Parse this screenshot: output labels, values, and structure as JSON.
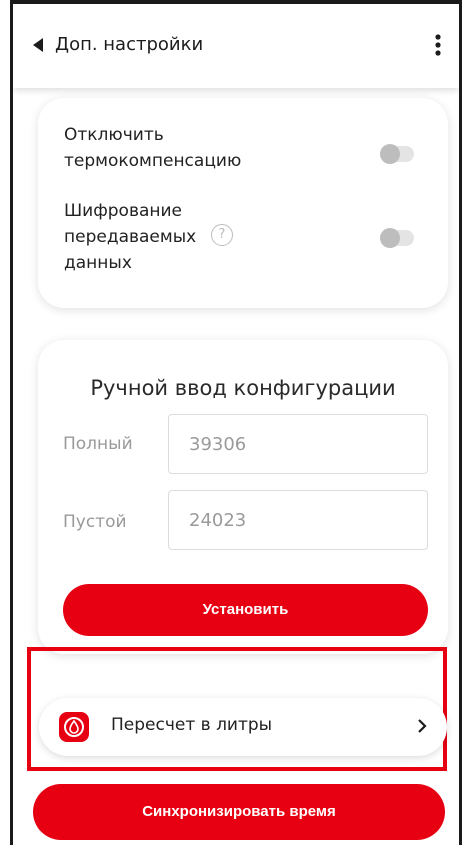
{
  "header": {
    "title": "Доп. настройки",
    "back_icon": "chevron-left-icon",
    "menu_icon": "more-vertical-icon"
  },
  "settings": {
    "thermo": {
      "line1": "Отключить",
      "line2": "термокомпенсацию",
      "enabled": false
    },
    "encryption": {
      "line1": "Шифрование",
      "line2": "передаваемых",
      "line3": "данных",
      "help": "?",
      "enabled": false
    }
  },
  "manual_config": {
    "title": "Ручной ввод конфигурации",
    "full_label": "Полный",
    "full_value": "39306",
    "empty_label": "Пустой",
    "empty_value": "24023",
    "set_button": "Установить"
  },
  "recalc": {
    "label": "Пересчет в литры",
    "icon": "drop-icon",
    "chevron": ">"
  },
  "sync_button": "Синхронизировать время",
  "colors": {
    "accent": "#e60012",
    "toggle_off": "#bdbdbd"
  }
}
